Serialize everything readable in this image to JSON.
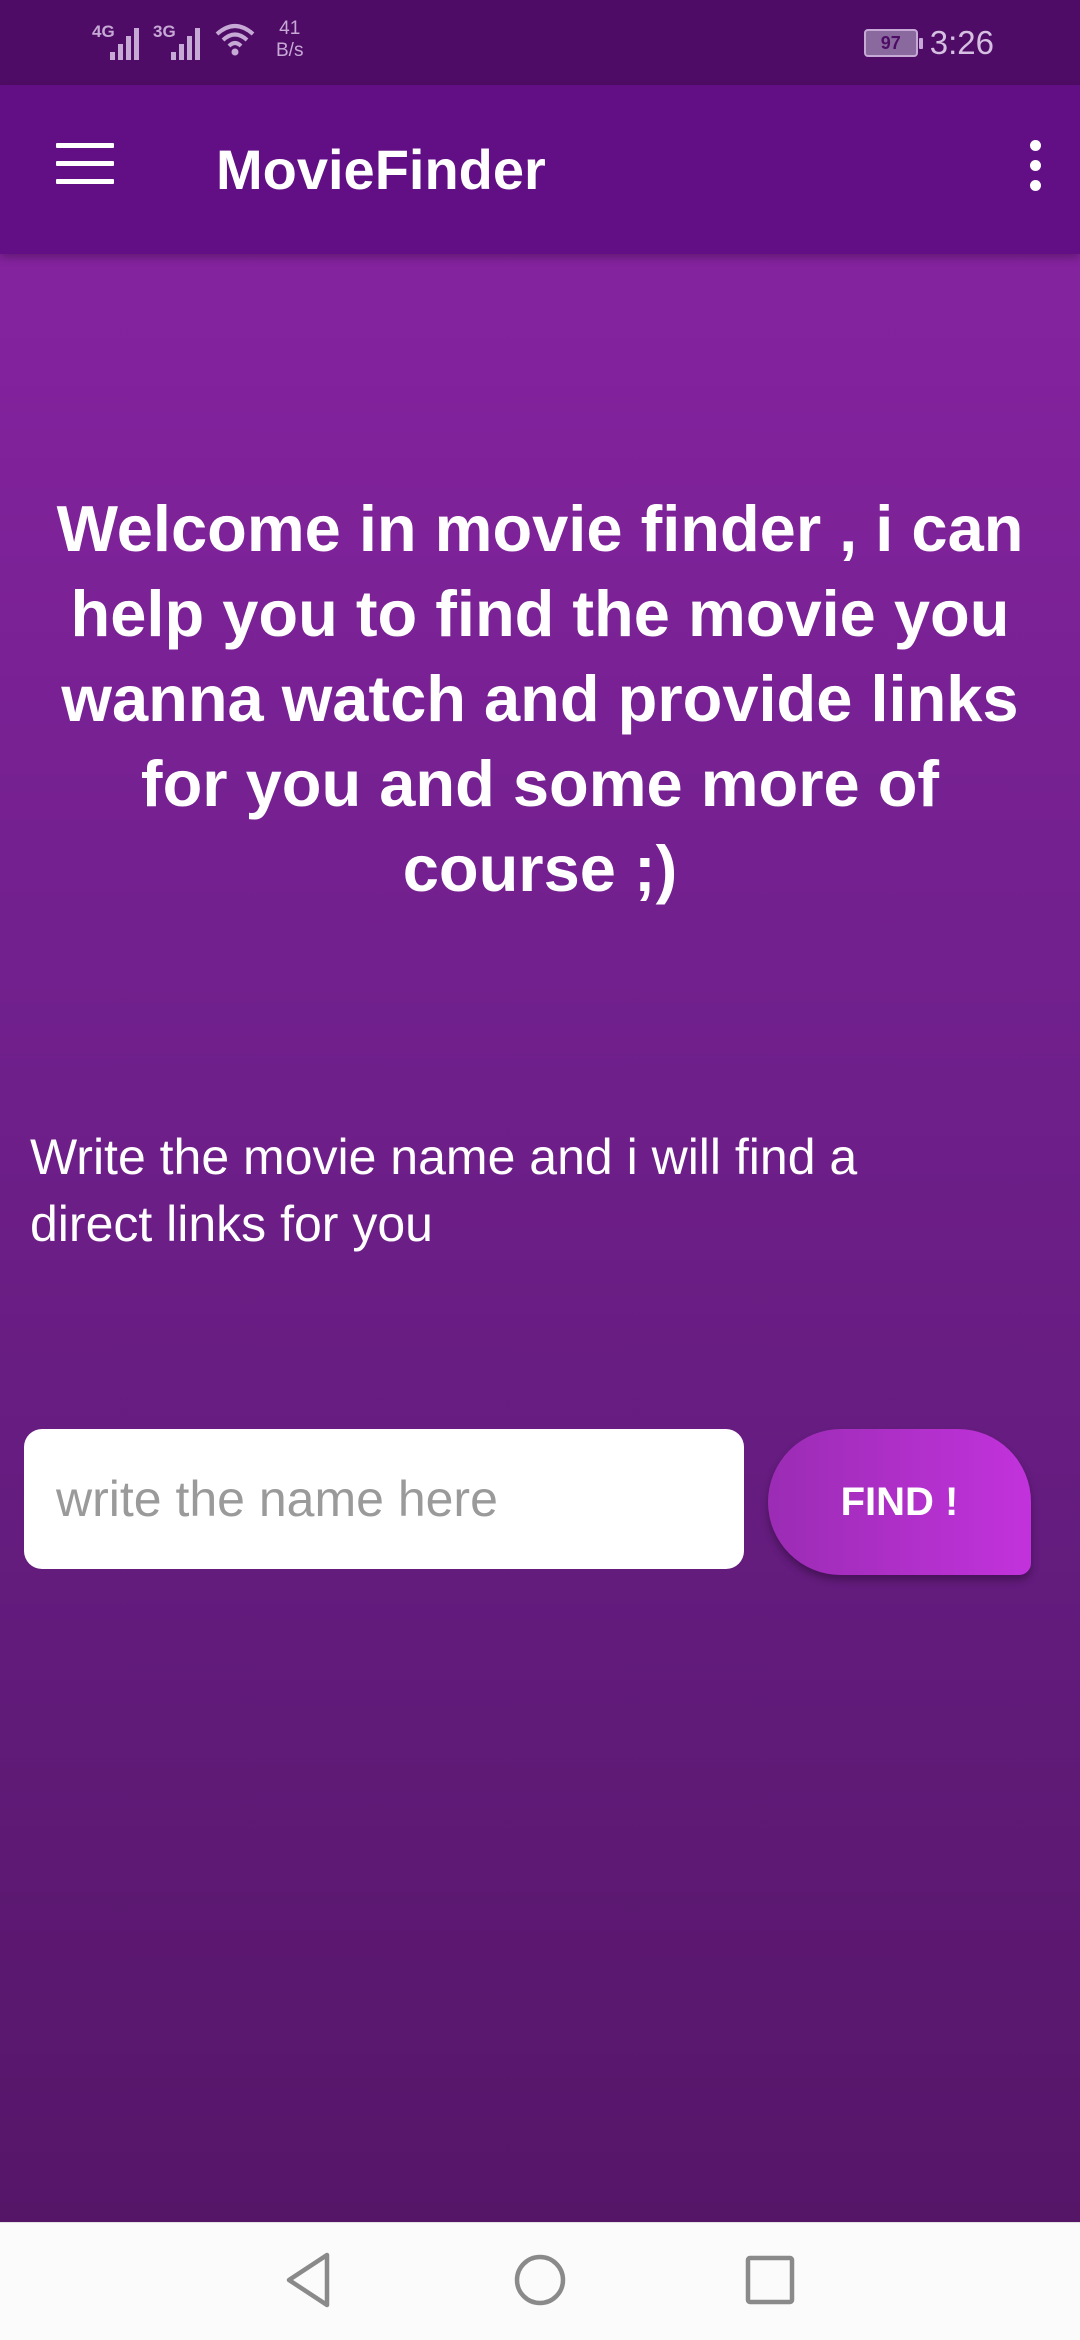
{
  "status_bar": {
    "signal_1_label": "4G",
    "signal_2_label": "3G",
    "net_speed_value": "41",
    "net_speed_unit": "B/s",
    "battery_level": "97",
    "time": "3:26"
  },
  "app_bar": {
    "title": "MovieFinder",
    "menu_icon": "hamburger-menu-icon",
    "overflow_icon": "more-vert-icon"
  },
  "main": {
    "welcome_text": "Welcome in movie finder , i can help you to find the movie you wanna watch and provide links for you and some more of course ;)",
    "instruction_text": "Write the movie name and i will find a direct links for you",
    "search": {
      "placeholder": "write the name here",
      "value": ""
    },
    "find_button_label": "FIND !"
  },
  "nav_bar": {
    "back_icon": "back-triangle-icon",
    "home_icon": "home-circle-icon",
    "recents_icon": "recents-square-icon"
  },
  "colors": {
    "status_bar": "#4f0c66",
    "app_bar": "#620f85",
    "background_top": "#85239f",
    "background_bottom": "#561668",
    "button_accent": "#c232dc"
  }
}
